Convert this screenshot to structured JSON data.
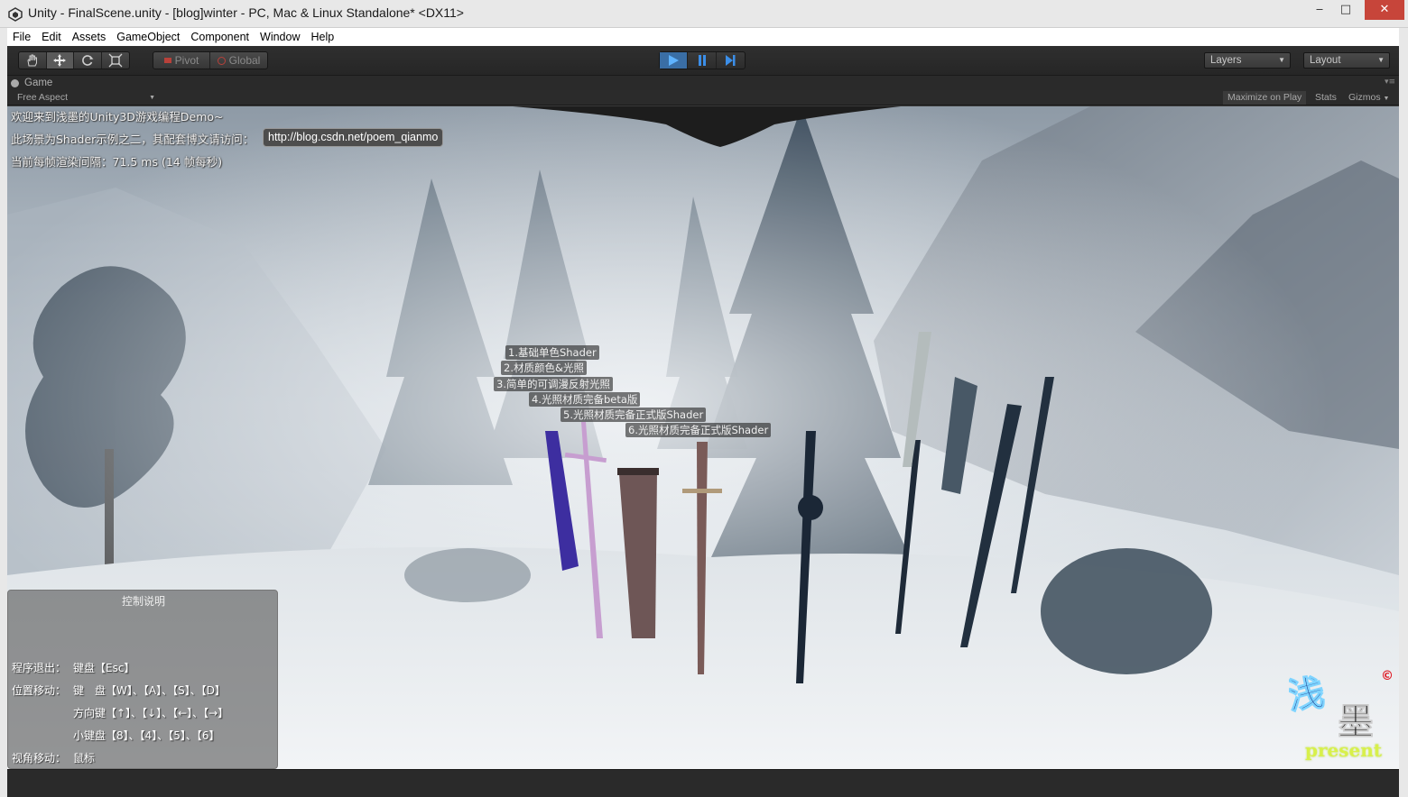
{
  "window": {
    "title": "Unity - FinalScene.unity - [blog]winter - PC, Mac & Linux Standalone* <DX11>",
    "controls": {
      "minimize": "‒",
      "maximize": "□",
      "close": "✕"
    }
  },
  "menu": [
    "File",
    "Edit",
    "Assets",
    "GameObject",
    "Component",
    "Window",
    "Help"
  ],
  "toolbar": {
    "tools": [
      "hand-icon",
      "move-icon",
      "rotate-icon",
      "scale-icon"
    ],
    "active_tool": "move-icon",
    "pivot_label": "Pivot",
    "global_label": "Global",
    "play_state": "playing",
    "layers_label": "Layers",
    "layout_label": "Layout"
  },
  "game_tab": {
    "label": "Game",
    "aspect": "Free Aspect",
    "maximize_on_play": "Maximize on Play",
    "stats": "Stats",
    "gizmos": "Gizmos"
  },
  "hud": {
    "welcome": "欢迎来到浅墨的Unity3D游戏编程Demo~",
    "scene_info": "此场景为Shader示例之二，其配套博文请访问：",
    "blog_link": "http://blog.csdn.net/poem_qianmo",
    "frame_time": "当前每帧渲染间隔：71.5 ms (14 帧每秒)"
  },
  "shader_labels": [
    "1.基础单色Shader",
    "2.材质颜色&光照",
    "3.简单的可调漫反射光照",
    "4.光照材质完备beta版",
    "5.光照材质完备正式版Shader",
    "6.光照材质完备正式版Shader"
  ],
  "controls_panel": {
    "title": "控制说明",
    "rows": [
      {
        "key": "程序退出：",
        "value": "键盘【Esc】"
      },
      {
        "key": "位置移动：",
        "value": "键　盘【W】、【A】、【S】、【D】"
      },
      {
        "key": "",
        "value": "方向键【↑】、【↓】、【←】、【→】"
      },
      {
        "key": "",
        "value": "小键盘【8】、【4】、【5】、【6】"
      },
      {
        "key": "视角移动：",
        "value": "鼠标"
      }
    ]
  },
  "logo": {
    "calligraphy": "浅墨",
    "copyright": "©",
    "tagline": "present"
  },
  "colors": {
    "editor_dark": "#2a2a2a",
    "play_active": "#3a6ea5",
    "close_button": "#c7453a",
    "snow": "#e8ecef"
  }
}
